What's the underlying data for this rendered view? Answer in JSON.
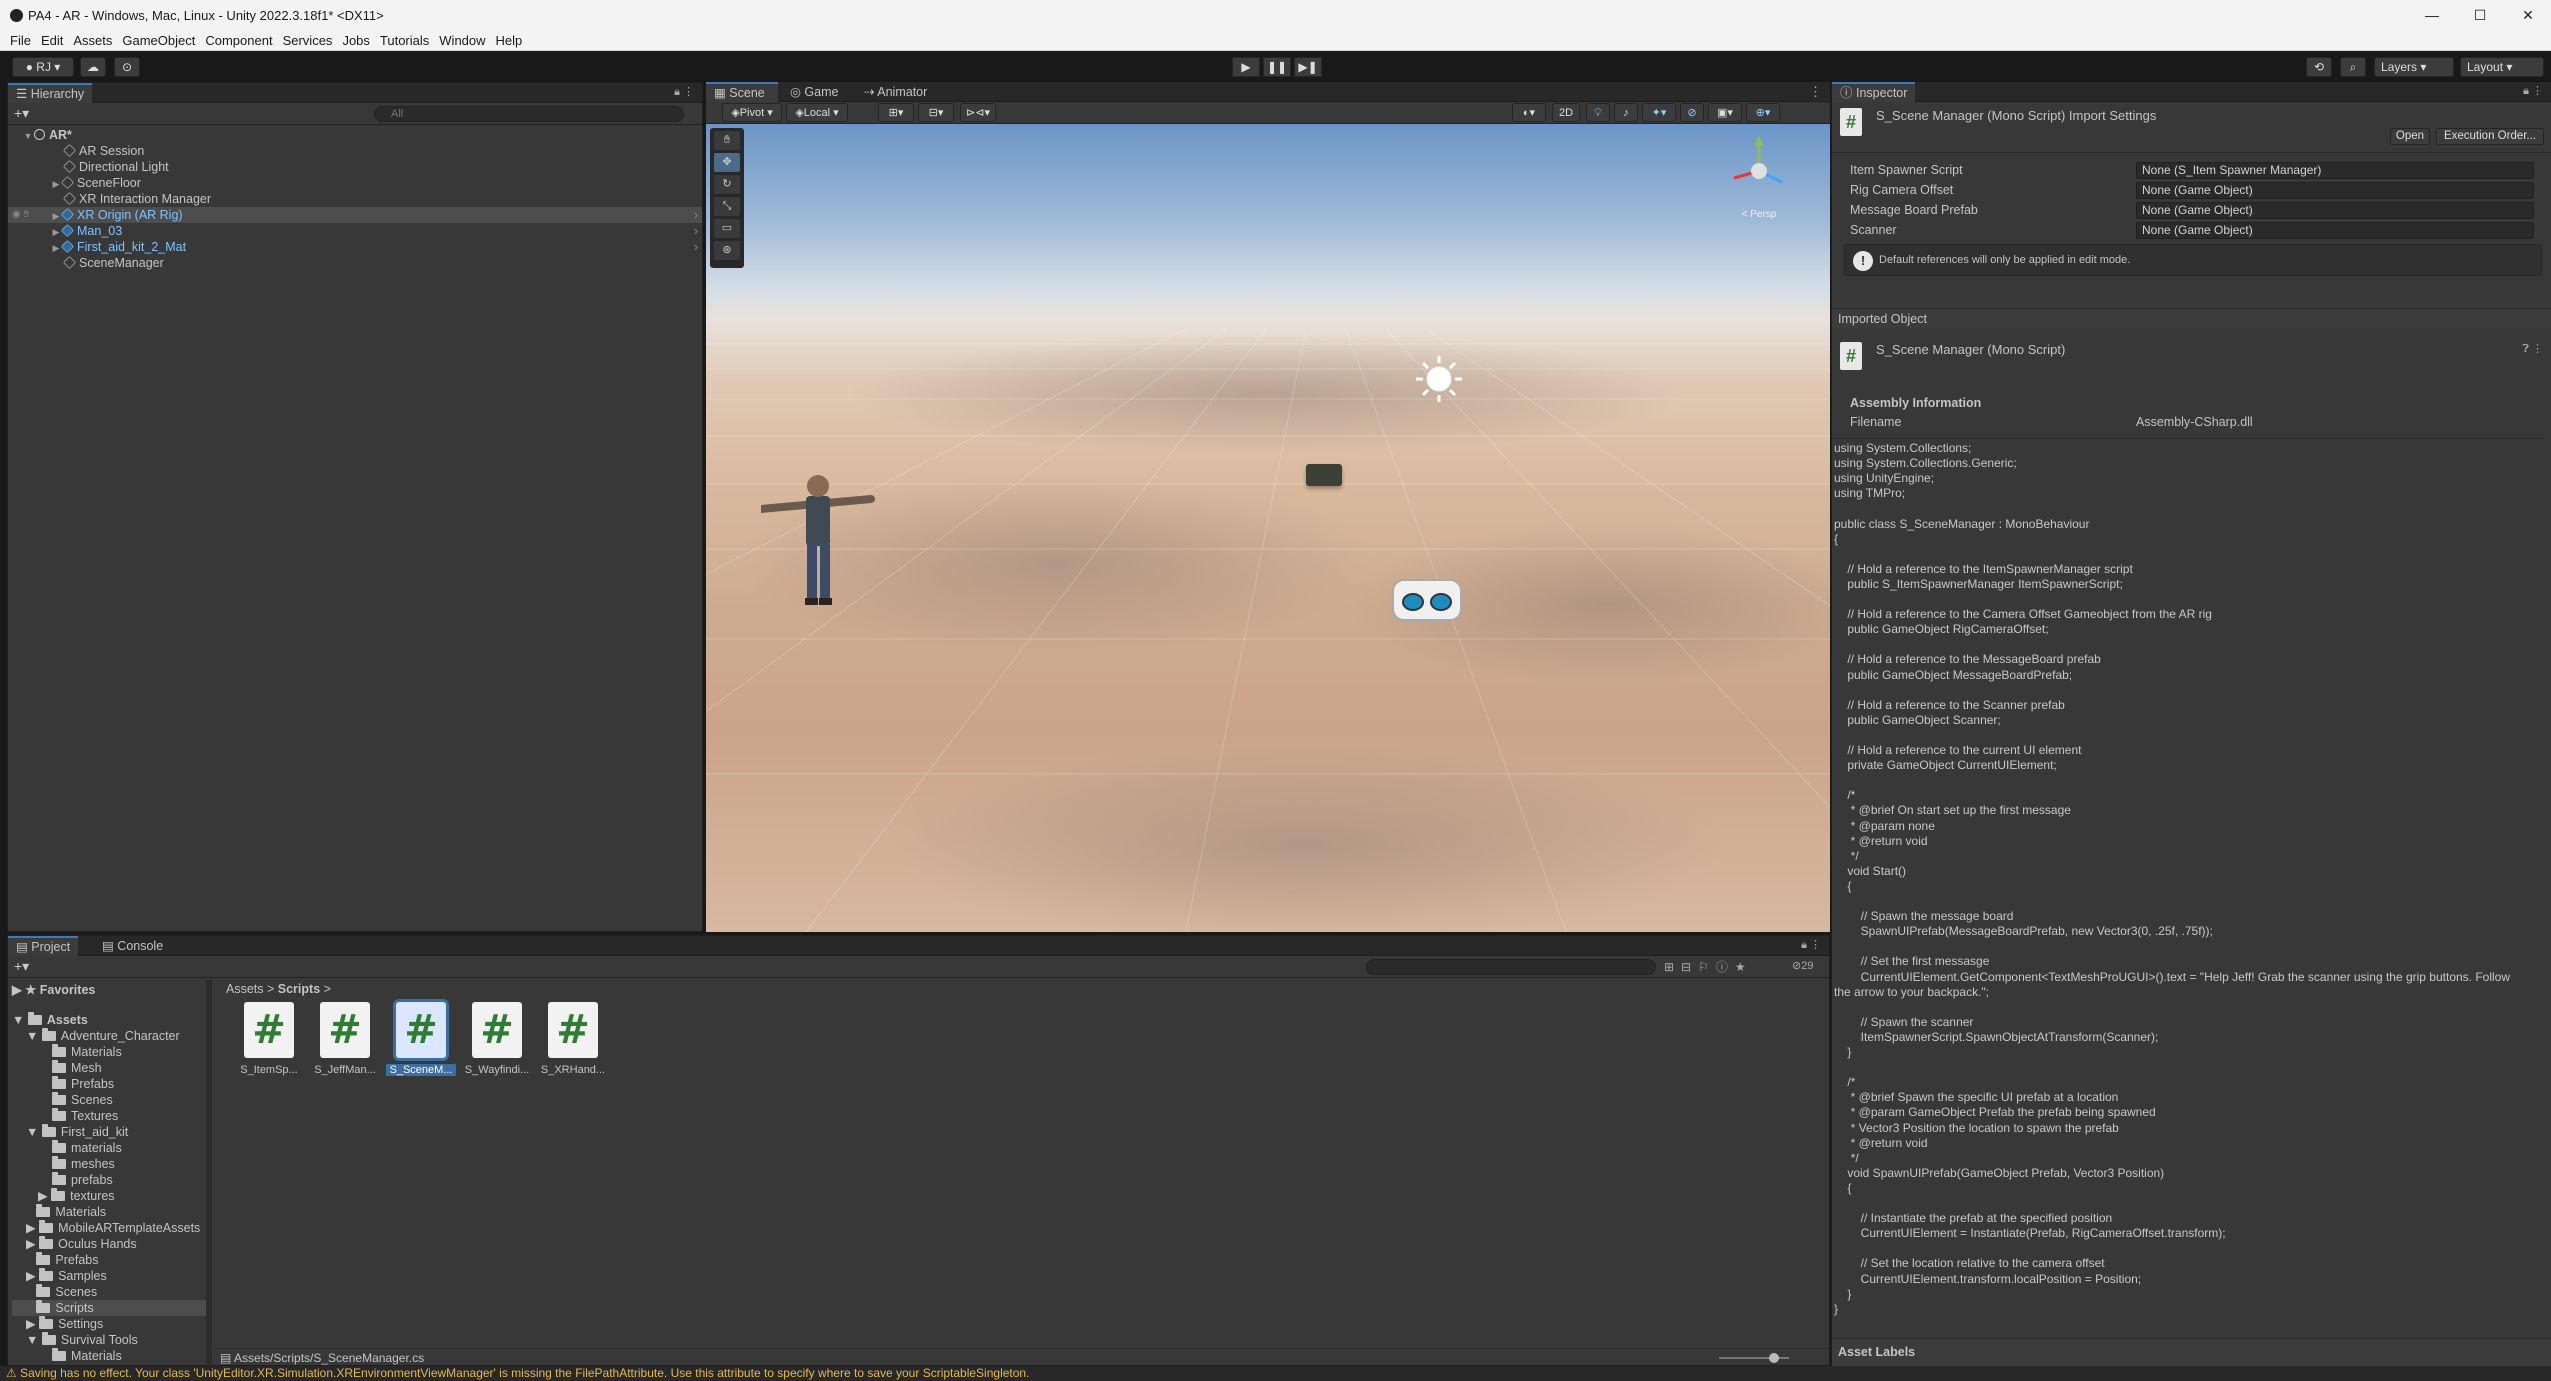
{
  "window": {
    "title": "PA4 - AR - Windows, Mac, Linux - Unity 2022.3.18f1* <DX11>",
    "min": "—",
    "max": "☐",
    "close": "✕"
  },
  "menu": [
    "File",
    "Edit",
    "Assets",
    "GameObject",
    "Component",
    "Services",
    "Jobs",
    "Tutorials",
    "Window",
    "Help"
  ],
  "toolbar": {
    "account": "RJ",
    "layers": "Layers",
    "layout": "Layout",
    "play": "▶",
    "pause": "❚❚",
    "step": "▶❚"
  },
  "hierarchy": {
    "tab": "Hierarchy",
    "search_placeholder": "All",
    "scene": "AR*",
    "items": [
      {
        "label": "AR Session"
      },
      {
        "label": "Directional Light"
      },
      {
        "label": "SceneFloor"
      },
      {
        "label": "XR Interaction Manager"
      },
      {
        "label": "XR Origin (AR Rig)"
      },
      {
        "label": "Man_03"
      },
      {
        "label": "First_aid_kit_2_Mat"
      },
      {
        "label": "SceneManager"
      }
    ]
  },
  "scene": {
    "tabs": [
      "Scene",
      "Game",
      "Animator"
    ],
    "pivot": "Pivot",
    "local": "Local",
    "two_d": "2D",
    "gizmo_label": "< Persp"
  },
  "inspector": {
    "tab": "Inspector",
    "header": "S_Scene Manager (Mono Script) Import Settings",
    "open_btn": "Open",
    "exec_btn": "Execution Order...",
    "props": [
      {
        "label": "Item Spawner Script",
        "value": "None (S_Item Spawner Manager)"
      },
      {
        "label": "Rig Camera Offset",
        "value": "None (Game Object)"
      },
      {
        "label": "Message Board Prefab",
        "value": "None (Game Object)"
      },
      {
        "label": "Scanner",
        "value": "None (Game Object)"
      }
    ],
    "note": "Default references will only be applied in edit mode.",
    "imported_object": "Imported Object",
    "script_name": "S_Scene Manager (Mono Script)",
    "assembly_info": "Assembly Information",
    "filename_label": "Filename",
    "filename_value": "Assembly-CSharp.dll",
    "code": [
      "using System.Collections;",
      "using System.Collections.Generic;",
      "using UnityEngine;",
      "using TMPro;",
      "",
      "public class S_SceneManager : MonoBehaviour",
      "{",
      "",
      "    // Hold a reference to the ItemSpawnerManager script",
      "    public S_ItemSpawnerManager ItemSpawnerScript;",
      "",
      "    // Hold a reference to the Camera Offset Gameobject from the AR rig",
      "    public GameObject RigCameraOffset;",
      "",
      "    // Hold a reference to the MessageBoard prefab",
      "    public GameObject MessageBoardPrefab;",
      "",
      "    // Hold a reference to the Scanner prefab",
      "    public GameObject Scanner;",
      "",
      "    // Hold a reference to the current UI element",
      "    private GameObject CurrentUIElement;",
      "",
      "    /*",
      "     * @brief On start set up the first message",
      "     * @param none",
      "     * @return void",
      "     */",
      "    void Start()",
      "    {",
      "",
      "        // Spawn the message board",
      "        SpawnUIPrefab(MessageBoardPrefab, new Vector3(0, .25f, .75f));",
      "",
      "        // Set the first messasge",
      "        CurrentUIElement.GetComponent<TextMeshProUGUI>().text = \"Help Jeff! Grab the scanner using the grip buttons. Follow",
      "the arrow to your backpack.\";",
      "",
      "        // Spawn the scanner",
      "        ItemSpawnerScript.SpawnObjectAtTransform(Scanner);",
      "    }",
      "",
      "    /*",
      "     * @brief Spawn the specific UI prefab at a location",
      "     * @param GameObject Prefab the prefab being spawned",
      "     * Vector3 Position the location to spawn the prefab",
      "     * @return void",
      "     */",
      "    void SpawnUIPrefab(GameObject Prefab, Vector3 Position)",
      "    {",
      "",
      "        // Instantiate the prefab at the specified position",
      "        CurrentUIElement = Instantiate(Prefab, RigCameraOffset.transform);",
      "",
      "        // Set the location relative to the camera offset",
      "        CurrentUIElement.transform.localPosition = Position;",
      "    }",
      "}"
    ],
    "asset_labels": "Asset Labels"
  },
  "project": {
    "tabs": [
      "Project",
      "Console"
    ],
    "count": "29",
    "favorites": "Favorites",
    "tree": [
      {
        "label": "Assets",
        "bold": true
      },
      {
        "label": "Adventure_Character"
      },
      {
        "label": "Materials"
      },
      {
        "label": "Mesh"
      },
      {
        "label": "Prefabs"
      },
      {
        "label": "Scenes"
      },
      {
        "label": "Textures"
      },
      {
        "label": "First_aid_kit"
      },
      {
        "label": "materials"
      },
      {
        "label": "meshes"
      },
      {
        "label": "prefabs"
      },
      {
        "label": "textures"
      },
      {
        "label": "Materials"
      },
      {
        "label": "MobileARTemplateAssets"
      },
      {
        "label": "Oculus Hands"
      },
      {
        "label": "Prefabs"
      },
      {
        "label": "Samples"
      },
      {
        "label": "Scenes"
      },
      {
        "label": "Scripts"
      },
      {
        "label": "Settings"
      },
      {
        "label": "Survival Tools"
      },
      {
        "label": "Materials"
      }
    ],
    "breadcrumb_root": "Assets",
    "breadcrumb_current": "Scripts",
    "assets": [
      {
        "label": "S_ItemSp..."
      },
      {
        "label": "S_JeffMan..."
      },
      {
        "label": "S_SceneM..."
      },
      {
        "label": "S_Wayfindi..."
      },
      {
        "label": "S_XRHand..."
      }
    ],
    "path": "Assets/Scripts/S_SceneManager.cs"
  },
  "status": {
    "message": "Saving has no effect. Your class 'UnityEditor.XR.Simulation.XREnvironmentViewManager' is missing the FilePathAttribute. Use this attribute to specify where to save your ScriptableSingleton."
  }
}
